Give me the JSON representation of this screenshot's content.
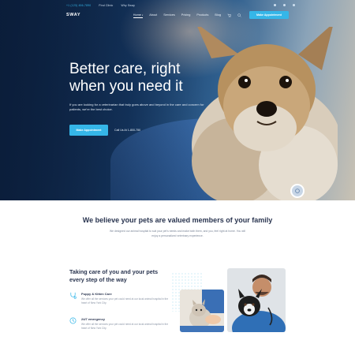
{
  "topbar": {
    "phone": "+1 (123) 456-7890",
    "links": [
      "Find Clinic",
      "Why Sway"
    ],
    "socials": [
      "facebook-icon",
      "twitter-icon",
      "instagram-icon"
    ]
  },
  "nav": {
    "logo": "SWAY",
    "items": [
      "Home",
      "About",
      "Services",
      "Pricing",
      "Products",
      "Blog"
    ],
    "active": "Home",
    "cta": "Make Appointment"
  },
  "hero": {
    "title": "Better care, right when you need it",
    "subtitle": "If you are looking for a veterinarian that truly goes above and beyond in the care and concern for patients, we're the best choice.",
    "cta": "Make Appointment",
    "call": "Call Us At 1-800-750"
  },
  "about": {
    "heading": "We believe your pets are valued members of your family",
    "text": "We designed our animal hospital to suit your pet's needs and make both them, and you, feel right at home. You will enjoy a personalized veterinary experience."
  },
  "care": {
    "heading": "Taking care of you and your pets every step of the way",
    "features": [
      {
        "title": "Puppy & Kitten Care",
        "desc": "We offer all the services your pet could need at our local animal hospital in the heart of New York City.",
        "icon": "paw-stethoscope-icon"
      },
      {
        "title": "24/7 emergency",
        "desc": "We offer all the services your pet could need at our local animal hospital in the heart of New York City.",
        "icon": "clock-emergency-icon"
      }
    ]
  },
  "colors": {
    "accent": "#35b6e8",
    "heading": "#2a3550",
    "hero_dark": "#0e2444"
  }
}
